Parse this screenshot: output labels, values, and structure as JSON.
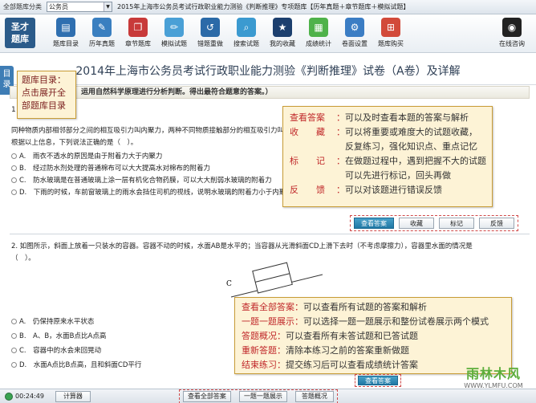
{
  "topbar": {
    "category_label": "全部题库分类",
    "category_value": "公务员",
    "exam_title": "2015年上海市公务员考试行政职业能力测验《判断推理》专项题库【历年真题＋章节题库＋模拟试题】"
  },
  "logo": {
    "line1": "圣才",
    "line2": "题库"
  },
  "toolbar": [
    {
      "label": "题库目录",
      "icon": "book-icon",
      "color": "#2f6fb0"
    },
    {
      "label": "历年真题",
      "icon": "paper-icon",
      "color": "#3a7fc0"
    },
    {
      "label": "章节题库",
      "icon": "chapter-icon",
      "color": "#c83a3a"
    },
    {
      "label": "模拟试题",
      "icon": "pencil-icon",
      "color": "#4aa0d6"
    },
    {
      "label": "错题重做",
      "icon": "redo-icon",
      "color": "#2b6aa8"
    },
    {
      "label": "搜索试题",
      "icon": "search-icon",
      "color": "#3b9ad0"
    },
    {
      "label": "我的收藏",
      "icon": "star-icon",
      "color": "#1c3f6e"
    },
    {
      "label": "成绩统计",
      "icon": "chart-icon",
      "color": "#4fb24a"
    },
    {
      "label": "卷面设置",
      "icon": "gear-icon",
      "color": "#3b7dc4"
    },
    {
      "label": "题库购买",
      "icon": "cart-icon",
      "color": "#d24a3a"
    },
    {
      "label": "在线咨询",
      "icon": "qq-icon",
      "color": "#222222"
    }
  ],
  "page_title": "2014年上海市公务员考试行政职业能力测验《判断推理》试卷（A卷）及详解",
  "dir_tab": "目录",
  "dir_callout": [
    "题库目录：",
    "点击展开全",
    "部题库目录"
  ],
  "section_head": "运用自然科学原理进行分析判断。得出最符合题意的答案。）",
  "q1": {
    "num": "1",
    "stem1": "同种物质内部相邻部分之间的相互吸引力叫内聚力，两种不同物质接触部分的相互吸引力叫附着力，当附着力大于内聚力时，就会出现液体润湿固体的现象",
    "stem2": "根据以上信息，下列说法正确的是（　）。",
    "options": [
      "A.　雨衣不透水的原因是由于附着力大于内聚力",
      "B.　经过防水剂处理的普通棉布可以大大提高水对棉布的附着力",
      "C.　防水玻璃是在普通玻璃上涂一层有机化合物药膜，可以大大削弱水玻璃的附着力",
      "D.　下雨的时候，车前窗玻璃上的雨水会挡住司机的视线，说明水玻璃的附着力小于内聚力"
    ]
  },
  "qa_callout": [
    {
      "key": "查看答案",
      "val": "可以及时查看本题的答案与解析"
    },
    {
      "key": "收　　藏",
      "val": "可以将重要或难度大的试题收藏，"
    },
    {
      "key": "",
      "val": "反复练习，强化知识点、重点记忆"
    },
    {
      "key": "标　　记",
      "val": "在做题过程中，遇到把握不大的试题"
    },
    {
      "key": "",
      "val": "可以先进行标记，回头再做"
    },
    {
      "key": "反　　馈",
      "val": "可以对该题进行错误反馈"
    }
  ],
  "q1_buttons": [
    "查看答案",
    "收藏",
    "标记",
    "反馈"
  ],
  "q2": {
    "stem1": "2. 如图所示，斜面上放着一只装水的容器。容器不动的时候，水面AB是水平的；当容器从光滑斜面CD上滑下去时（不考虑摩擦力），容器里水面的情况是",
    "stem2": "（　）。",
    "figure_label": "C",
    "options": [
      "A.　仍保持原来水平状态",
      "B.　A、B，水面B点比A点高",
      "C.　容器中的水会来回晃动",
      "D.　水面A点比B点高，且和斜面CD平行"
    ]
  },
  "bottom_callout": [
    {
      "key": "查看全部答案",
      "val": "可以查看所有试题的答案和解析"
    },
    {
      "key": "一题一题展示",
      "val": "可以选择一题一题展示和整份试卷展示两个模式"
    },
    {
      "key": "答题概况",
      "val": "可以查看所有未答试题和已答试题"
    },
    {
      "key": "重新答题",
      "val": "清除本练习之前的答案重新做题"
    },
    {
      "key": "结束练习",
      "val": "提交练习后可以查看成绩统计答案"
    }
  ],
  "q2_button": "查看答案",
  "status": {
    "time": "00:24:49",
    "calculator": "计算器",
    "buttons": [
      "查看全部答案",
      "一题一题展示",
      "答题概况"
    ]
  },
  "watermark": {
    "big": "雨林木风",
    "small": "WWW.YLMFU.COM"
  }
}
